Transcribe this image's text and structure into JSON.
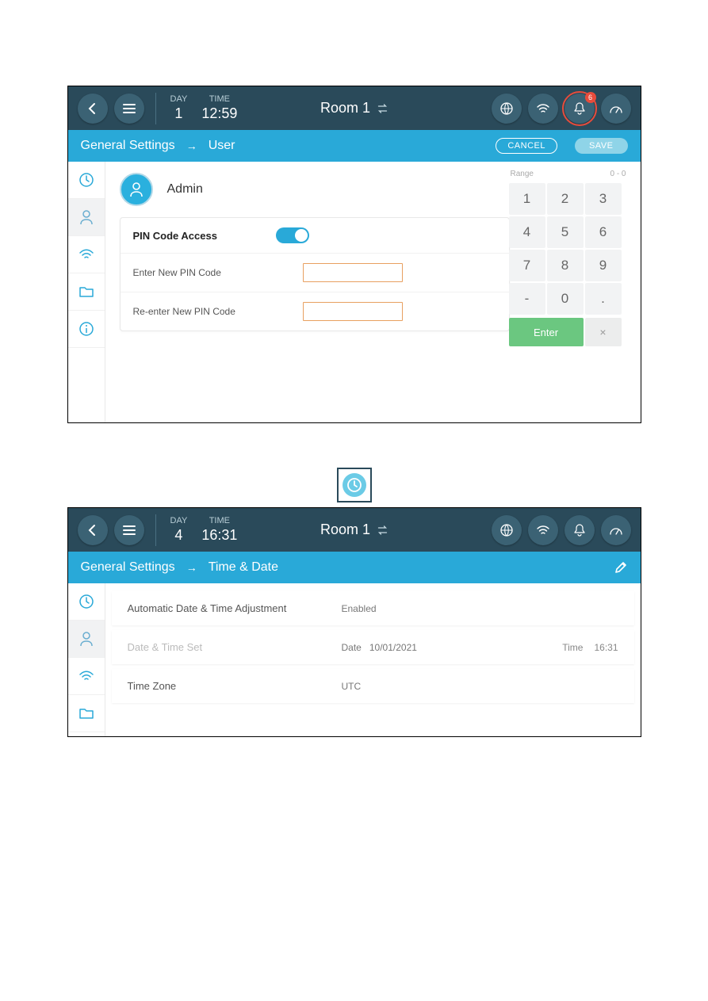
{
  "s1": {
    "header": {
      "day_label": "DAY",
      "day_value": "1",
      "time_label": "TIME",
      "time_value": "12:59",
      "room": "Room 1",
      "badge": "6"
    },
    "subheader": {
      "breadcrumb_root": "General Settings",
      "breadcrumb_leaf": "User",
      "cancel": "CANCEL",
      "save": "SAVE"
    },
    "user": "Admin",
    "pin_label": "PIN Code Access",
    "enter_pin": "Enter New PIN Code",
    "reenter_pin": "Re-enter New PIN Code",
    "keypad": {
      "range_label": "Range",
      "range_value": "0 - 0",
      "keys": [
        "1",
        "2",
        "3",
        "4",
        "5",
        "6",
        "7",
        "8",
        "9",
        "-",
        "0",
        "."
      ],
      "enter": "Enter",
      "clear": "×"
    }
  },
  "s2": {
    "header": {
      "day_label": "DAY",
      "day_value": "4",
      "time_label": "TIME",
      "time_value": "16:31",
      "room": "Room 1"
    },
    "subheader": {
      "breadcrumb_root": "General Settings",
      "breadcrumb_leaf": "Time & Date"
    },
    "rows": {
      "auto_label": "Automatic Date & Time Adjustment",
      "auto_value": "Enabled",
      "set_label": "Date & Time Set",
      "date_label": "Date",
      "date_value": "10/01/2021",
      "time_label": "Time",
      "time_value": "16:31",
      "tz_label": "Time Zone",
      "tz_value": "UTC"
    }
  }
}
